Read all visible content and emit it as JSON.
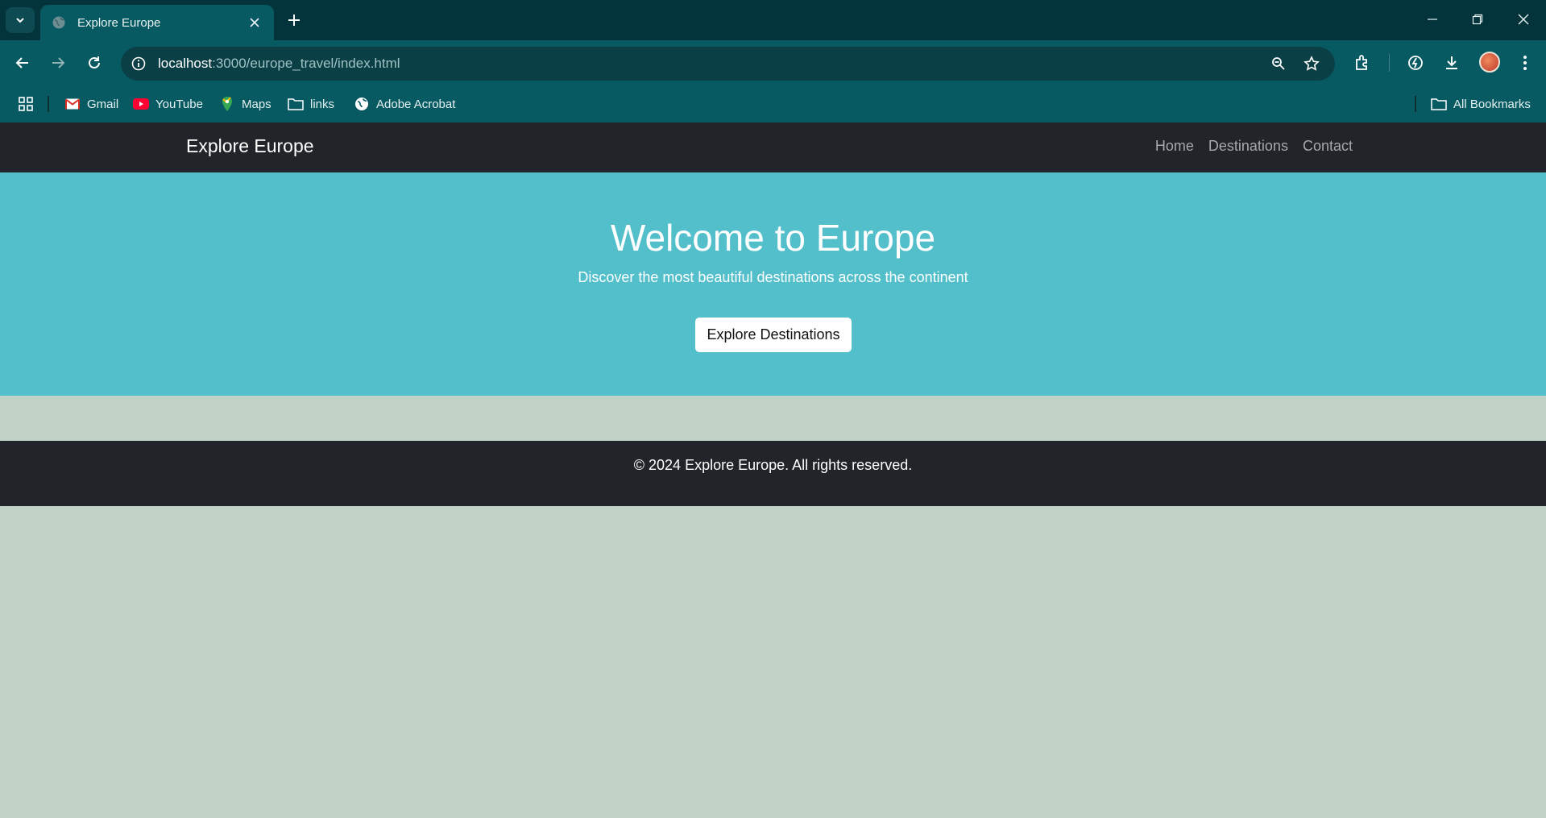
{
  "browser": {
    "tab_title": "Explore Europe",
    "url_host": "localhost",
    "url_path": ":3000/europe_travel/index.html",
    "bookmarks": [
      {
        "label": "Gmail",
        "icon": "gmail-icon"
      },
      {
        "label": "YouTube",
        "icon": "youtube-icon"
      },
      {
        "label": "Maps",
        "icon": "maps-icon"
      },
      {
        "label": "links",
        "icon": "folder-icon"
      },
      {
        "label": "Adobe Acrobat",
        "icon": "globe-icon"
      }
    ],
    "all_bookmarks": "All Bookmarks",
    "colors": {
      "tabstrip": "#03343b",
      "toolbar": "#075a62"
    }
  },
  "site": {
    "brand": "Explore Europe",
    "nav": [
      "Home",
      "Destinations",
      "Contact"
    ],
    "hero": {
      "title": "Welcome to Europe",
      "subtitle": "Discover the most beautiful destinations across the continent",
      "button": "Explore Destinations"
    },
    "footer": "© 2024 Explore Europe. All rights reserved.",
    "colors": {
      "navbar": "#212529",
      "hero": "#52bfcb",
      "body": "#c1d3c7"
    }
  }
}
